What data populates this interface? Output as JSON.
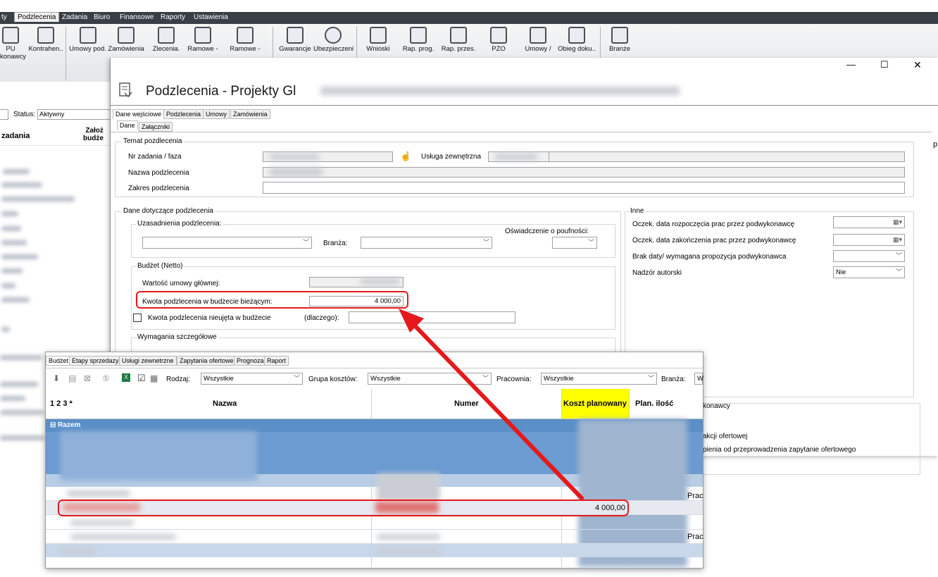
{
  "menu": [
    "ty",
    "Podzlecenia",
    "Zadania",
    "Biuro",
    "Finansowe",
    "Raporty",
    "Ustawienia"
  ],
  "ribbon": [
    "PU\nkonawcy",
    "Kontrahen..",
    "Umowy pod.",
    "Zamówienia",
    "Zlecenia.",
    "Ramowe -",
    "Ramowe -",
    "Gwarancje",
    "Ubezpieczeni",
    "Wnioski",
    "Rap. prog.",
    "Rap. przes.",
    "PZO",
    "Umowy /",
    "Obieg doku..",
    "Branże"
  ],
  "left": {
    "status_label": "Status:",
    "status_value": "Aktywny",
    "col_zadania": "zadania",
    "col_zalozone": "Założ\nbudże"
  },
  "dialog": {
    "title": "Podzlecenia - Projekty Gl",
    "controls": {
      "minimize": "—",
      "maximize": "☐",
      "close": "✕"
    },
    "tabs": [
      "Dane wejściowe",
      "Podzlecenia",
      "Umowy",
      "Zamówienia"
    ],
    "subtabs": [
      "Dane",
      "Załączniki"
    ],
    "temat": {
      "group": "Temat pozdlecenia",
      "nr_label": "Nr zadania / faza",
      "usluga_label": "Usługa zewnętrzna",
      "nazwa_label": "Nazwa podzlecenia",
      "zakres_label": "Zakres podzlecenia"
    },
    "dane": {
      "group": "Dane dotyczące podzlecenia",
      "uzasadnienia": "Uzasadnienia podzlecenia:",
      "oswiadczenie": "Oświadczenie o poufności:",
      "branza": "Branża:"
    },
    "budzet": {
      "group": "Budżet (Netto)",
      "wartosc": "Wartość umowy głównej:",
      "kwota": "Kwota podzlecenia w budżecie bieżącym:",
      "kwota_value": "4 000,00",
      "nieujeta": "Kwota podzlecenia nieujęta w budżecie",
      "dlaczego": "(dlaczego):"
    },
    "wymagania": {
      "group": "Wymagania szczegółowe"
    },
    "inne": {
      "group": "Inne",
      "r1": "Oczek. data rozpoczęcia prac przez podwykonawcę",
      "r2": "Oczek. data zakończenia prac przez podwykonawcę",
      "r3": "Brak daty/ wymagana propozycja podwykonawca",
      "r4": "Nadzór autorski",
      "r4_value": "Nie"
    },
    "right_bits": {
      "a": "konawcy",
      "b": "akcji ofertowej",
      "c": "pienia od przeprowadzenia zapytanie ofertowego",
      "p": "p"
    }
  },
  "grid": {
    "tabs": [
      "Budżet",
      "Etapy sprzedazy",
      "Usługi zewnetrzne",
      "Zapytania ofertowe",
      "Prognoza",
      "Raport"
    ],
    "filters": {
      "rodzaj_label": "Rodzaj:",
      "rodzaj_value": "Wszystkie",
      "grupa_label": "Grupa kosztów:",
      "grupa_value": "Wszystkie",
      "pracownia_label": "Pracownia:",
      "pracownia_value": "Wszystkie",
      "branza_label": "Branża:",
      "branza_value": "W"
    },
    "headers": {
      "levels": "1 2 3 *",
      "nazwa": "Nazwa",
      "numer": "Numer",
      "koszt": "Koszt planowany",
      "ilosc": "Plan. ilość"
    },
    "razem": "Razem",
    "highlighted_value": "4 000,00",
    "side": [
      "Prac",
      "Prac"
    ]
  },
  "colors": {
    "highlight": "#e5191b",
    "koszt_header": "#ffff00",
    "group_row": "#5b8fc7"
  }
}
